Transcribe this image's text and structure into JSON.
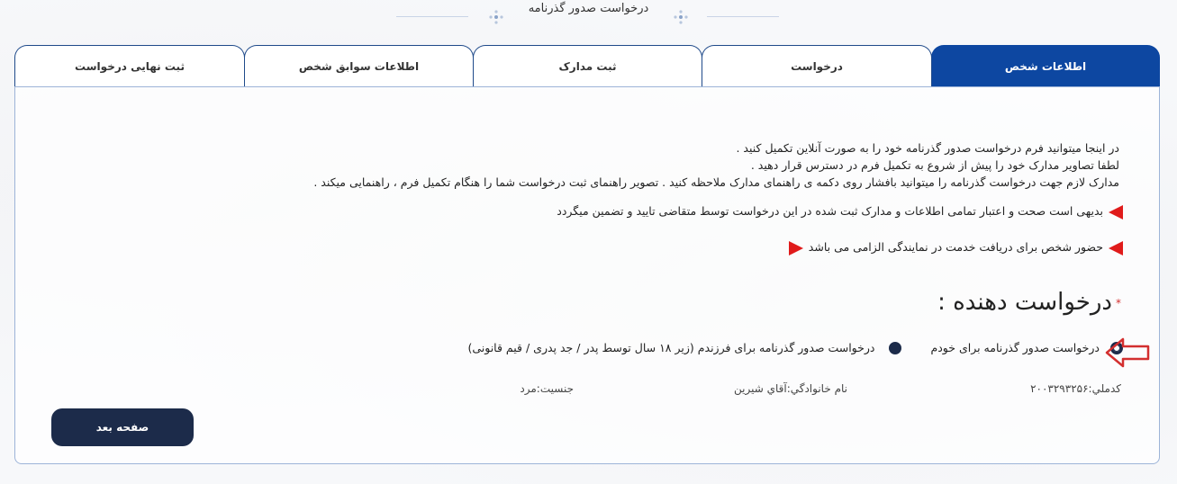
{
  "page": {
    "title": "درخواست صدور گذرنامه"
  },
  "tabs": [
    {
      "label": "اطلاعات شخص",
      "active": true
    },
    {
      "label": "درخواست",
      "active": false
    },
    {
      "label": "ثبت مدارک",
      "active": false
    },
    {
      "label": "اطلاعات سوابق شخص",
      "active": false
    },
    {
      "label": "ثبت نهایی درخواست",
      "active": false
    }
  ],
  "info": {
    "lines": [
      "در اینجا میتوانید فرم درخواست صدور گذرنامه خود را به صورت آنلاین تکمیل کنید .",
      "لطفا تصاویر مدارک خود را پیش از شروع به تکمیل فرم در دسترس قرار دهید .",
      "مدارک لازم جهت درخواست گذرنامه را میتوانید بافشار روی دکمه ی راهنمای مدارک ملاحظه کنید . تصویر راهنمای ثبت درخواست شما را هنگام تکمیل فرم ، راهنمایی میکند ."
    ],
    "notice_1": "بدیهی است صحت و اعتبار تمامی اطلاعات و مدارک ثبت شده در این درخواست توسط متقاضی تایید و تضمین میگردد",
    "notice_2": "حضور شخص برای دریافت خدمت در نمایندگی الزامی می باشد"
  },
  "requester": {
    "required_mark": "*",
    "title": "درخواست دهنده :",
    "options": [
      {
        "label": "درخواست صدور گذرنامه برای خودم",
        "selected": true
      },
      {
        "label": "درخواست صدور گذرنامه برای فرزندم (زیر ۱۸ سال توسط پدر / جد پدری / قیم قانونی)",
        "selected": false
      }
    ]
  },
  "person": {
    "national_code": "کدملي:۲۰۰۳۲۹۳۲۵۶",
    "family_name": "نام خانوادگي:آقاي شيرين",
    "gender": "جنسیت:مرد"
  },
  "buttons": {
    "next": "صفحه بعد"
  },
  "colors": {
    "primary": "#0d47a1",
    "dark": "#1c2b4a",
    "alert": "#e01b1b"
  },
  "icons": {
    "selection_arrow": "arrow-left-outline-icon",
    "notice_marker": "red-triangle-icon"
  }
}
